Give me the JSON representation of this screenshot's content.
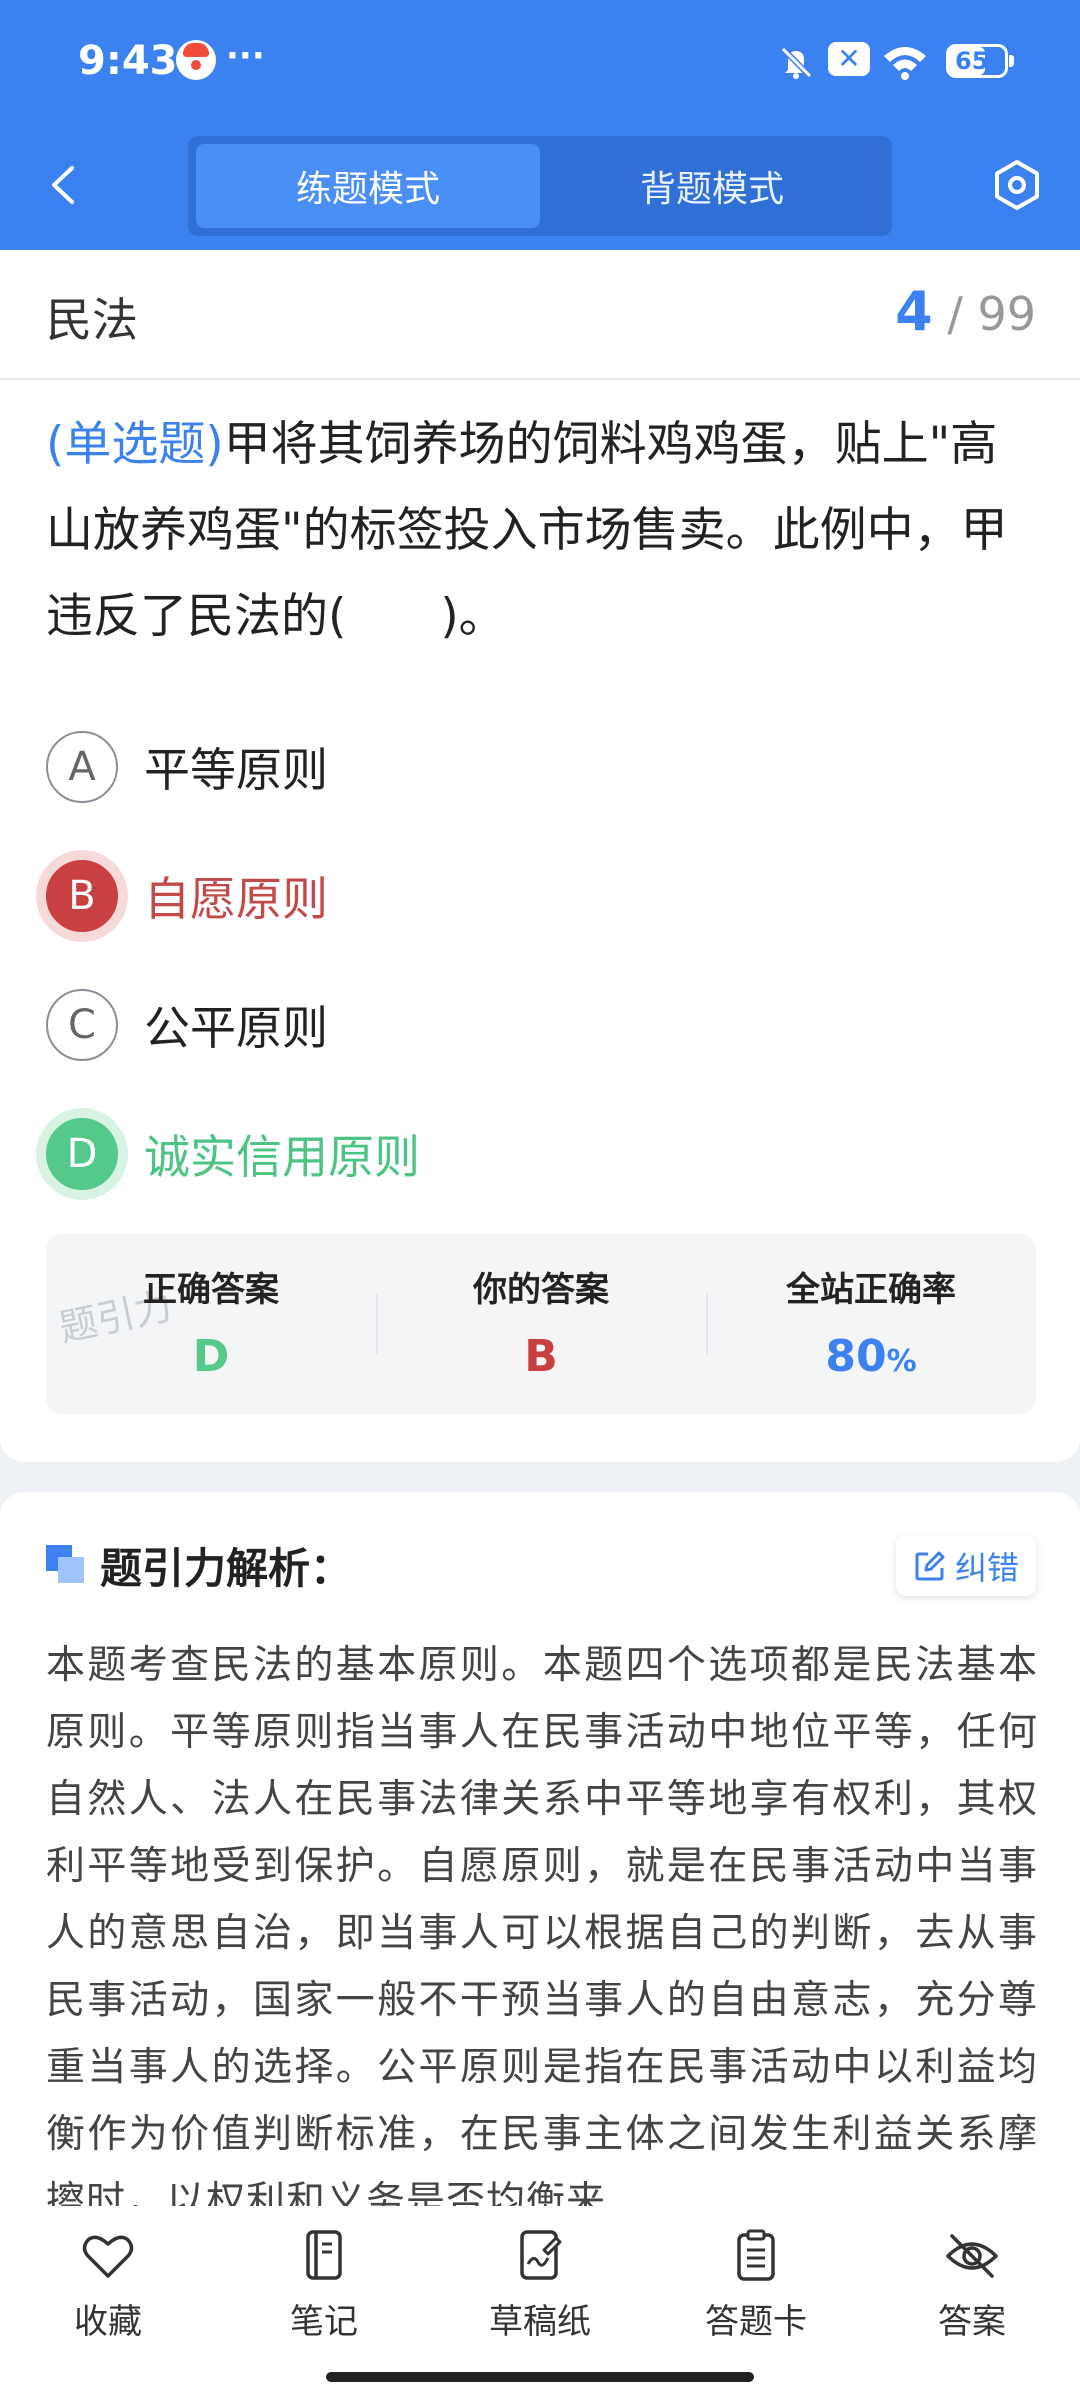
{
  "status_bar": {
    "time": "9:43",
    "more": "···",
    "battery": "65"
  },
  "header": {
    "tabs": [
      {
        "label": "练题模式",
        "active": true
      },
      {
        "label": "背题模式",
        "active": false
      }
    ],
    "accent_color": "#3b82f0"
  },
  "topic": {
    "name": "民法",
    "current": "4",
    "separator": "/",
    "total": "99"
  },
  "question": {
    "type": "(单选题)",
    "text": "甲将其饲养场的饲料鸡鸡蛋，贴上\"高山放养鸡蛋\"的标签投入市场售卖。此例中，甲违反了民法的(　　)。"
  },
  "options": [
    {
      "letter": "A",
      "text": "平等原则",
      "state": "normal"
    },
    {
      "letter": "B",
      "text": "自愿原则",
      "state": "wrong"
    },
    {
      "letter": "C",
      "text": "公平原则",
      "state": "normal"
    },
    {
      "letter": "D",
      "text": "诚实信用原则",
      "state": "correct"
    }
  ],
  "answer_summary": {
    "correct_label": "正确答案",
    "correct_value": "D",
    "mine_label": "你的答案",
    "mine_value": "B",
    "rate_label": "全站正确率",
    "rate_value": "80",
    "rate_unit": "%",
    "watermark": "题引力"
  },
  "analysis": {
    "title": "题引力解析：",
    "report_label": "纠错",
    "text": "本题考查民法的基本原则。本题四个选项都是民法基本原则。平等原则指当事人在民事活动中地位平等，任何自然人、法人在民事法律关系中平等地享有权利，其权利平等地受到保护。自愿原则，就是在民事活动中当事人的意思自治，即当事人可以根据自己的判断，去从事民事活动，国家一般不干预当事人的自由意志，充分尊重当事人的选择。公平原则是指在民事活动中以利益均衡作为价值判断标准，在民事主体之间发生利益关系摩擦时，以权利和义务是否均衡来"
  },
  "bottom_nav": [
    {
      "label": "收藏",
      "icon": "heart-icon"
    },
    {
      "label": "笔记",
      "icon": "notebook-icon"
    },
    {
      "label": "草稿纸",
      "icon": "draft-icon"
    },
    {
      "label": "答题卡",
      "icon": "answer-card-icon"
    },
    {
      "label": "答案",
      "icon": "eye-off-icon"
    }
  ]
}
